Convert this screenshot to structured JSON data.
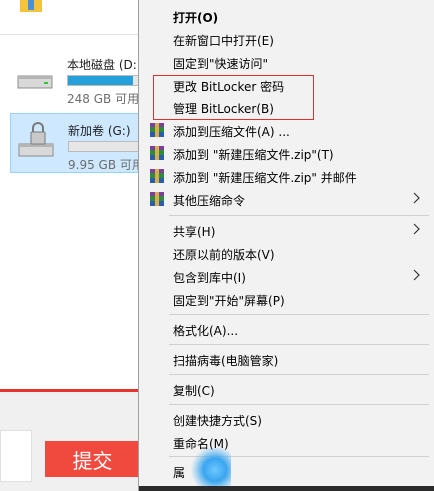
{
  "explorer": {
    "drives": [
      {
        "name": "本地磁盘 (D:)",
        "space": "248 GB 可用",
        "used_fraction": 0.85
      },
      {
        "name": "新加卷 (G:)",
        "space": "9.95 GB 可用",
        "used_fraction": 0.0
      }
    ],
    "submit_label": "提交"
  },
  "context_menu": {
    "items": [
      {
        "label": "打开(O)"
      },
      {
        "label": "在新窗口中打开(E)"
      },
      {
        "label": "固定到\"快速访问\""
      },
      {
        "label": "更改 BitLocker 密码"
      },
      {
        "label": "管理 BitLocker(B)"
      },
      {
        "label": "添加到压缩文件(A) ..."
      },
      {
        "label": "添加到 \"新建压缩文件.zip\"(T)"
      },
      {
        "label": "添加到 \"新建压缩文件.zip\" 并邮件"
      },
      {
        "label": "其他压缩命令"
      },
      {
        "label": "共享(H)"
      },
      {
        "label": "还原以前的版本(V)"
      },
      {
        "label": "包含到库中(I)"
      },
      {
        "label": "固定到\"开始\"屏幕(P)"
      },
      {
        "label": "格式化(A)..."
      },
      {
        "label": "扫描病毒(电脑管家)"
      },
      {
        "label": "复制(C)"
      },
      {
        "label": "创建快捷方式(S)"
      },
      {
        "label": "重命名(M)"
      },
      {
        "label": "属"
      }
    ]
  },
  "colors": {
    "highlight_border": "#e03030",
    "submit_bg": "#f04a3f",
    "selection_bg": "#cde8ff",
    "bar_fill": "#26a0da"
  }
}
